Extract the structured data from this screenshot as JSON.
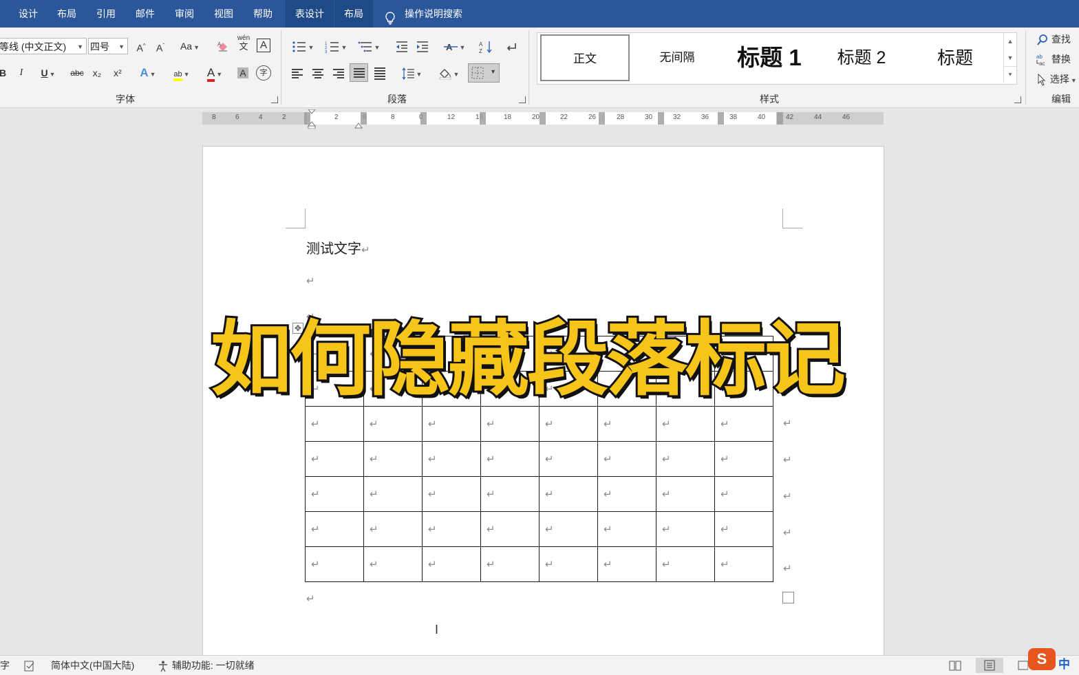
{
  "menu": {
    "tabs": [
      {
        "label": "设计"
      },
      {
        "label": "布局"
      },
      {
        "label": "引用"
      },
      {
        "label": "邮件"
      },
      {
        "label": "审阅"
      },
      {
        "label": "视图"
      },
      {
        "label": "帮助"
      },
      {
        "label": "表设计"
      },
      {
        "label": "布局"
      }
    ],
    "tell_me": "操作说明搜索"
  },
  "ribbon": {
    "font": {
      "font_name": "等线 (中文正文)",
      "font_size": "四号",
      "grow_label": "A",
      "shrink_label": "A",
      "case_label": "Aa",
      "pinyin_label": "wén",
      "pinyin_char": "文",
      "border_char_label": "A",
      "bold": "B",
      "italic": "I",
      "underline": "U",
      "strike": "abc",
      "sub": "x₂",
      "sup": "x²",
      "effects": "A",
      "highlight": "ab",
      "color": "A",
      "shading": "A",
      "enclose": "字",
      "group_label": "字体"
    },
    "paragraph": {
      "group_label": "段落"
    },
    "styles": {
      "items": [
        {
          "label": "正文"
        },
        {
          "label": "无间隔"
        },
        {
          "label": "标题 1"
        },
        {
          "label": "标题 2"
        },
        {
          "label": "标题"
        }
      ],
      "group_label": "样式"
    },
    "editing": {
      "find": "查找",
      "replace": "替换",
      "select": "选择",
      "group_label": "编辑"
    }
  },
  "ruler": {
    "left_labels": [
      "8",
      "6",
      "4",
      "2"
    ],
    "right_labels": [
      "2",
      "6",
      "8",
      "0",
      "12",
      "16",
      "18",
      "20",
      "22",
      "26",
      "28",
      "30",
      "32",
      "36",
      "38",
      "40",
      "42",
      "44",
      "46"
    ]
  },
  "document": {
    "first_line": "测试文字",
    "paragraph_mark": "↵",
    "table": {
      "rows": 7,
      "cols": 8
    }
  },
  "overlay": {
    "title": "如何隐藏段落标记"
  },
  "statusbar": {
    "word_count": "字",
    "language": "简体中文(中国大陆)",
    "accessibility": "辅助功能: 一切就绪"
  },
  "ime": {
    "logo": "S",
    "mode": "中"
  },
  "colors": {
    "ribbon_blue": "#2b579a",
    "overlay_yellow": "#f7c41a",
    "font_color_red": "#e02020",
    "highlight_yellow": "#ffff00",
    "ime_orange": "#e8561f"
  }
}
